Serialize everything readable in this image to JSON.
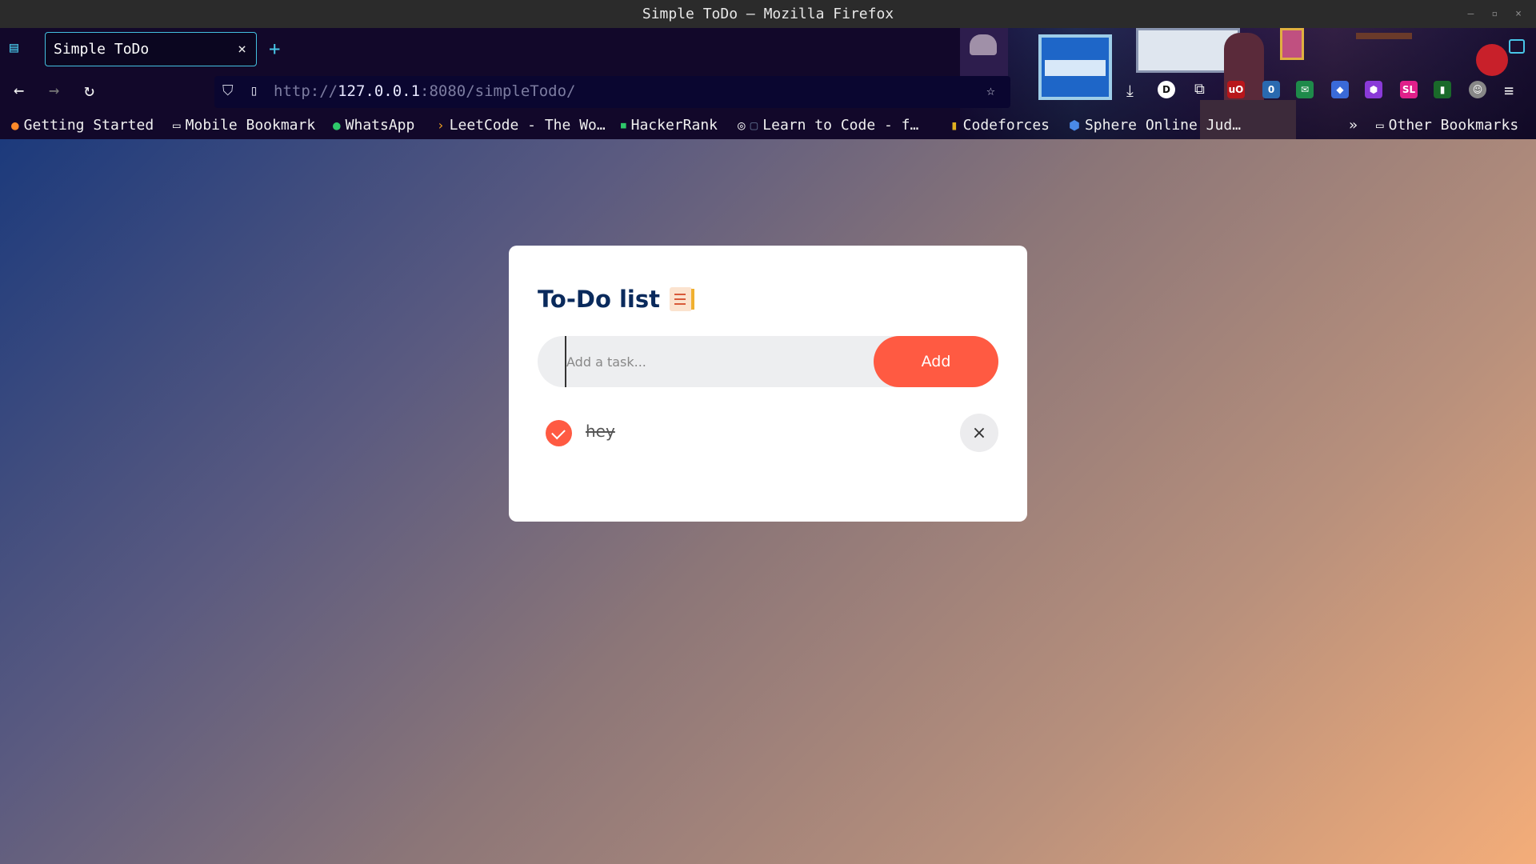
{
  "window": {
    "title": "Simple ToDo — Mozilla Firefox",
    "controls": [
      "–",
      "▫",
      "×"
    ]
  },
  "browser": {
    "tab": {
      "title": "Simple ToDo",
      "close": "×"
    },
    "new_tab": "+",
    "url": {
      "scheme": "http://",
      "host": "127.0.0.1",
      "rest": ":8080/simpleTodo/"
    },
    "bookmarks": [
      {
        "label": "Getting Started",
        "icon": "firefox-icon"
      },
      {
        "label": "Mobile Bookmark",
        "icon": "folder-icon"
      },
      {
        "label": "WhatsApp",
        "icon": "whatsapp-icon"
      },
      {
        "label": "LeetCode - The Wo…",
        "icon": "leetcode-icon"
      },
      {
        "label": "HackerRank",
        "icon": "hackerrank-icon"
      },
      {
        "label": "Learn to Code - f…",
        "icon": "globe-icon"
      },
      {
        "label": "Codeforces",
        "icon": "codeforces-icon"
      },
      {
        "label": "Sphere Online Jud…",
        "icon": "spoj-icon"
      }
    ],
    "other_bookmarks": "Other Bookmarks",
    "extensions": [
      {
        "label": "D",
        "color": "#ffffff"
      },
      {
        "label": "uO",
        "color": "#b8161b"
      },
      {
        "label": "0",
        "color": "#2a6ab0"
      },
      {
        "label": "SL",
        "color": "#e0208a"
      }
    ]
  },
  "app": {
    "title": "To-Do list",
    "input_placeholder": "Add a task...",
    "add_label": "Add",
    "tasks": [
      {
        "text": "hey",
        "done": true
      }
    ],
    "delete_symbol": "×"
  },
  "colors": {
    "accent": "#ff5a42",
    "title": "#0a2a5c",
    "tab_border": "#43c0e0"
  }
}
